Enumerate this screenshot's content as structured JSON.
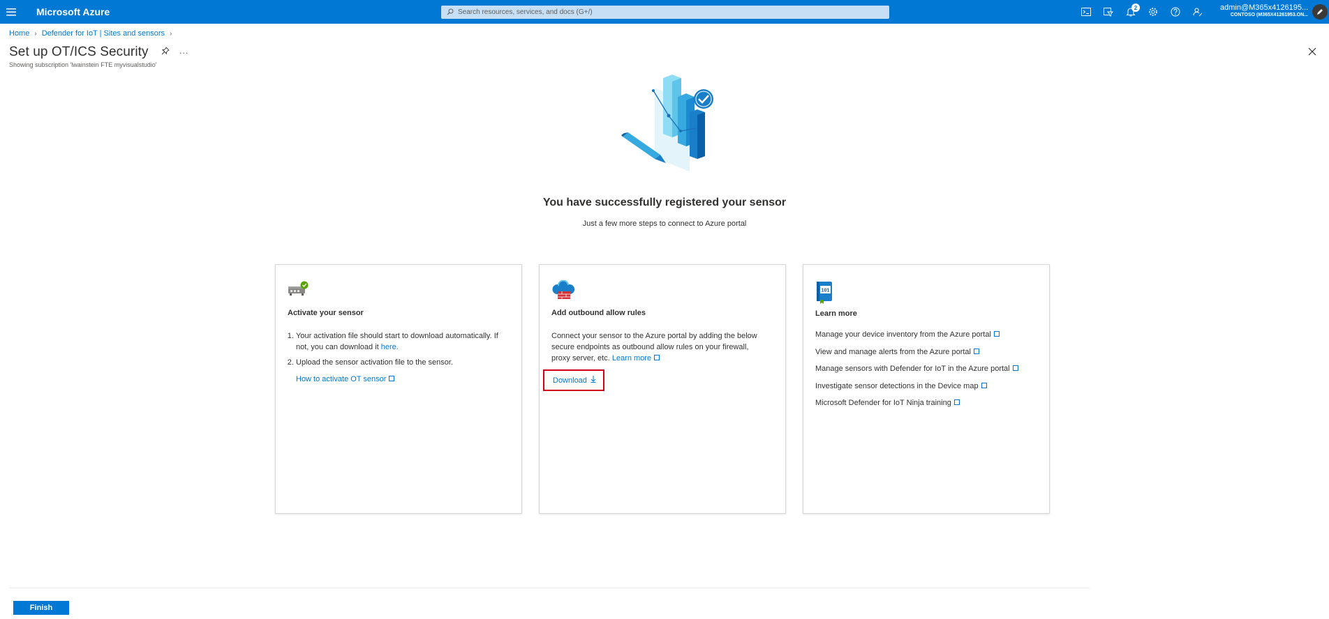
{
  "header": {
    "brand": "Microsoft Azure",
    "search_placeholder": "Search resources, services, and docs (G+/)",
    "notifications_count": "2",
    "account_user": "admin@M365x4126195...",
    "account_tenant": "CONTOSO (M365X41261953.ON...",
    "icons": [
      "cloud-shell-icon",
      "directory-filter-icon",
      "notifications-icon",
      "settings-icon",
      "help-icon",
      "feedback-icon"
    ]
  },
  "breadcrumb": {
    "home": "Home",
    "item1": "Defender for IoT | Sites and sensors"
  },
  "page": {
    "title": "Set up OT/ICS Security",
    "subtitle": "Showing subscription 'lwainstein FTE myvisualstudio'",
    "hero_title": "You have successfully registered your sensor",
    "hero_subtitle": "Just a few more steps to connect to Azure portal"
  },
  "cards": {
    "activate": {
      "title": "Activate your sensor",
      "step1_text": "Your activation file should start to download automatically. If not, you can download it",
      "step1_link": "here.",
      "step2_text": "Upload the sensor activation file to the sensor.",
      "howto_link": "How to activate OT sensor"
    },
    "outbound": {
      "title": "Add outbound allow rules",
      "body": "Connect your sensor to the Azure portal by adding the below secure endpoints as outbound allow rules on your firewall, proxy server, etc.",
      "learn_more": "Learn more",
      "download": "Download"
    },
    "learn": {
      "title": "Learn more",
      "book_label": "101",
      "links": [
        "Manage your device inventory from the Azure portal",
        "View and manage alerts from the Azure portal",
        "Manage sensors with Defender for IoT in the Azure portal",
        "Investigate sensor detections in the Device map",
        "Microsoft Defender for IoT Ninja training"
      ]
    }
  },
  "footer": {
    "finish": "Finish"
  },
  "colors": {
    "accent": "#0078d4",
    "highlight_border": "#d0021b"
  }
}
